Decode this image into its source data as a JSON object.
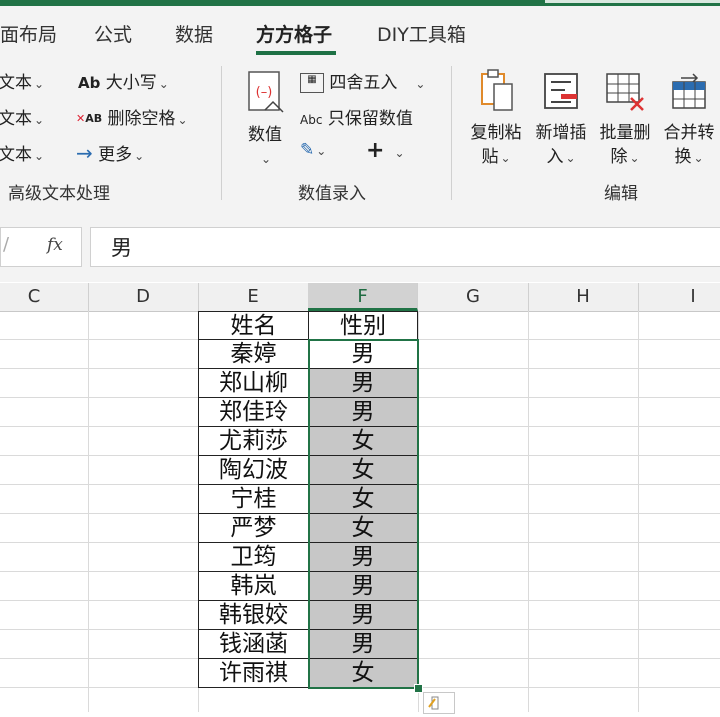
{
  "tabs": [
    {
      "label": "面布局",
      "active": false
    },
    {
      "label": "公式",
      "active": false
    },
    {
      "label": "数据",
      "active": false
    },
    {
      "label": "方方格子",
      "active": true
    },
    {
      "label": "DIY工具箱",
      "active": false
    }
  ],
  "ribbon": {
    "left_partial": [
      "文本",
      "文本",
      "文本"
    ],
    "text_case": "大小写",
    "remove_spaces": "删除空格",
    "more": "更多",
    "group_text": "高级文本处理",
    "value_btn": "数值",
    "round": "四舍五入",
    "keep_numbers": "只保留数值",
    "group_value": "数值录入",
    "copy_paste_1": "复制粘",
    "copy_paste_2": "贴",
    "add_insert_1": "新增插",
    "add_insert_2": "入",
    "batch_delete_1": "批量删",
    "batch_delete_2": "除",
    "merge_convert_1": "合并转",
    "merge_convert_2": "换",
    "group_edit": "编辑",
    "ab_label": "Ab",
    "abc_label": "Abc",
    "xab_label": "AB"
  },
  "formula_bar": {
    "fx": "fx",
    "value": "男"
  },
  "columns": [
    "C",
    "D",
    "E",
    "F",
    "G",
    "H",
    "I"
  ],
  "selected_column": "F",
  "table": {
    "header_name": "姓名",
    "header_gender": "性别",
    "rows": [
      {
        "name": "秦婷",
        "gender": "男"
      },
      {
        "name": "郑山柳",
        "gender": "男"
      },
      {
        "name": "郑佳玲",
        "gender": "男"
      },
      {
        "name": "尤莉莎",
        "gender": "女"
      },
      {
        "name": "陶幻波",
        "gender": "女"
      },
      {
        "name": "宁桂",
        "gender": "女"
      },
      {
        "name": "严梦",
        "gender": "女"
      },
      {
        "name": "卫筠",
        "gender": "男"
      },
      {
        "name": "韩岚",
        "gender": "男"
      },
      {
        "name": "韩银姣",
        "gender": "男"
      },
      {
        "name": "钱涵菡",
        "gender": "男"
      },
      {
        "name": "许雨祺",
        "gender": "女"
      }
    ]
  },
  "colors": {
    "accent": "#217346",
    "selection_fill": "#c7c7c7"
  }
}
